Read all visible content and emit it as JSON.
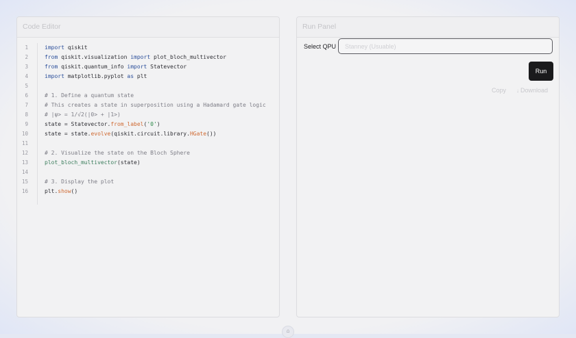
{
  "editor": {
    "title": "Code Editor",
    "lines": [
      {
        "n": "1",
        "parts": [
          {
            "t": "import",
            "c": "kw"
          },
          {
            "t": " qiskit",
            "c": ""
          }
        ]
      },
      {
        "n": "2",
        "parts": [
          {
            "t": "from",
            "c": "kw"
          },
          {
            "t": " qiskit.visualization ",
            "c": ""
          },
          {
            "t": "import",
            "c": "kw"
          },
          {
            "t": " plot_bloch_multivector",
            "c": ""
          }
        ]
      },
      {
        "n": "3",
        "parts": [
          {
            "t": "from",
            "c": "kw"
          },
          {
            "t": " qiskit.quantum_info ",
            "c": ""
          },
          {
            "t": "import",
            "c": "kw"
          },
          {
            "t": " Statevector",
            "c": ""
          }
        ]
      },
      {
        "n": "4",
        "parts": [
          {
            "t": "import",
            "c": "kw"
          },
          {
            "t": " matplotlib.pyplot ",
            "c": ""
          },
          {
            "t": "as",
            "c": "kw"
          },
          {
            "t": " plt",
            "c": ""
          }
        ]
      },
      {
        "n": "5",
        "parts": []
      },
      {
        "n": "6",
        "parts": [
          {
            "t": "# 1. Define a quantum state",
            "c": "cm"
          }
        ]
      },
      {
        "n": "7",
        "parts": [
          {
            "t": "# This creates a state in superposition using a Hadamard gate logic",
            "c": "cm"
          }
        ]
      },
      {
        "n": "8",
        "parts": [
          {
            "t": "# |ψ> = 1/√2(|0> + |1>)",
            "c": "cm"
          }
        ]
      },
      {
        "n": "9",
        "parts": [
          {
            "t": "state = Statevector.",
            "c": ""
          },
          {
            "t": "from_label",
            "c": "fn-orange"
          },
          {
            "t": "(",
            "c": ""
          },
          {
            "t": "'0'",
            "c": "str"
          },
          {
            "t": ")",
            "c": ""
          }
        ]
      },
      {
        "n": "10",
        "parts": [
          {
            "t": "state = state.",
            "c": ""
          },
          {
            "t": "evolve",
            "c": "fn-orange"
          },
          {
            "t": "(qiskit.circuit.library.",
            "c": ""
          },
          {
            "t": "HGate",
            "c": "fn-orange"
          },
          {
            "t": "())",
            "c": ""
          }
        ]
      },
      {
        "n": "11",
        "parts": []
      },
      {
        "n": "12",
        "parts": [
          {
            "t": "# 2. Visualize the state on the Bloch Sphere",
            "c": "cm"
          }
        ]
      },
      {
        "n": "13",
        "parts": [
          {
            "t": "plot_bloch_multivector",
            "c": "fn-green"
          },
          {
            "t": "(state)",
            "c": ""
          }
        ]
      },
      {
        "n": "14",
        "parts": []
      },
      {
        "n": "15",
        "parts": [
          {
            "t": "# 3. Display the plot",
            "c": "cm"
          }
        ]
      },
      {
        "n": "16",
        "parts": [
          {
            "t": "plt.",
            "c": ""
          },
          {
            "t": "show",
            "c": "fn-orange"
          },
          {
            "t": "()",
            "c": ""
          }
        ]
      }
    ]
  },
  "run_panel": {
    "title": "Run Panel",
    "qpu_label": "Select QPU",
    "qpu_placeholder": "Stanney (Usuable)",
    "run_label": "Run",
    "copy_label": "Copy",
    "download_label": "Download",
    "download_icon": "↓"
  },
  "footer": {
    "handle_icon": "⌂"
  },
  "colors": {
    "run_button_bg": "#1a1a1c",
    "keyword": "#2a4e9a",
    "function": "#cf6a32"
  }
}
